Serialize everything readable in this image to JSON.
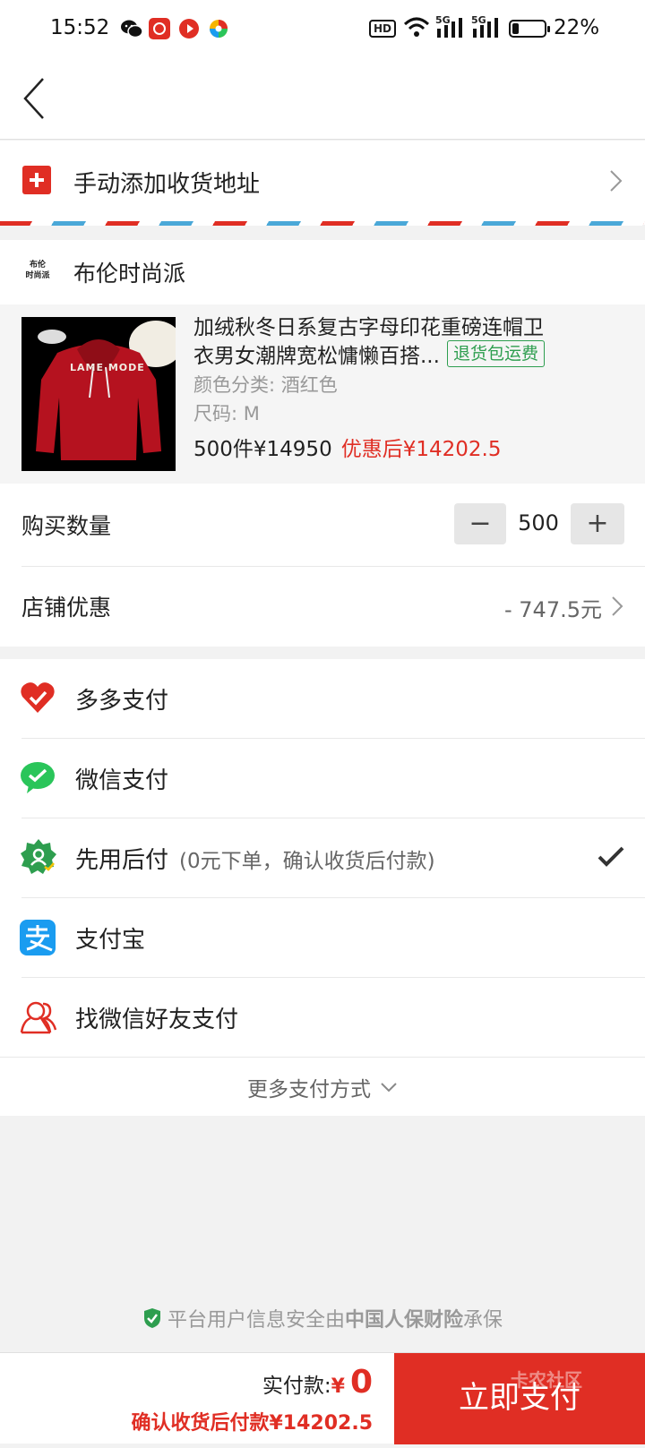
{
  "status_bar": {
    "time": "15:52",
    "net1": "5G",
    "net2": "5G",
    "hd": "HD",
    "battery": "22%",
    "battery_level": 0.22
  },
  "address": {
    "label": "手动添加收货地址"
  },
  "shop": {
    "logo_line1": "布伦",
    "logo_line2": "时尚派",
    "name": "布伦时尚派"
  },
  "product": {
    "title_line1": "加绒秋冬日系复古字母印花重磅连帽卫",
    "title_line2": "衣男女潮牌宽松慵懒百搭...",
    "badge": "退货包运费",
    "color": "颜色分类: 酒红色",
    "size": "尺码: M",
    "price": "500件¥14950",
    "discount_price": "优惠后¥14202.5",
    "image_text": "LAME MODE"
  },
  "quantity": {
    "label": "购买数量",
    "value": "500",
    "minus": "−",
    "plus": "+"
  },
  "discount": {
    "label": "店铺优惠",
    "value": "- 747.5元"
  },
  "payments": [
    {
      "label": "多多支付"
    },
    {
      "label": "微信支付"
    },
    {
      "label": "先用后付",
      "note": "(0元下单，确认收货后付款)"
    },
    {
      "label": "支付宝"
    },
    {
      "label": "找微信好友支付"
    }
  ],
  "more_payments": "更多支付方式",
  "footer_note": {
    "prefix": "平台用户信息安全由",
    "brand": "中国人保财险",
    "suffix": "承保"
  },
  "bottom": {
    "pay_label": "实付款: ",
    "currency": "¥",
    "amount": "0",
    "confirm_note": "确认收货后付款¥14202.5",
    "button": "立即支付",
    "watermark": "卡农社区"
  },
  "colors": {
    "accent": "#e02e24",
    "wechat": "#2ac55a",
    "alipay": "#1a9cf0",
    "green_badge": "#2e9e4f"
  }
}
